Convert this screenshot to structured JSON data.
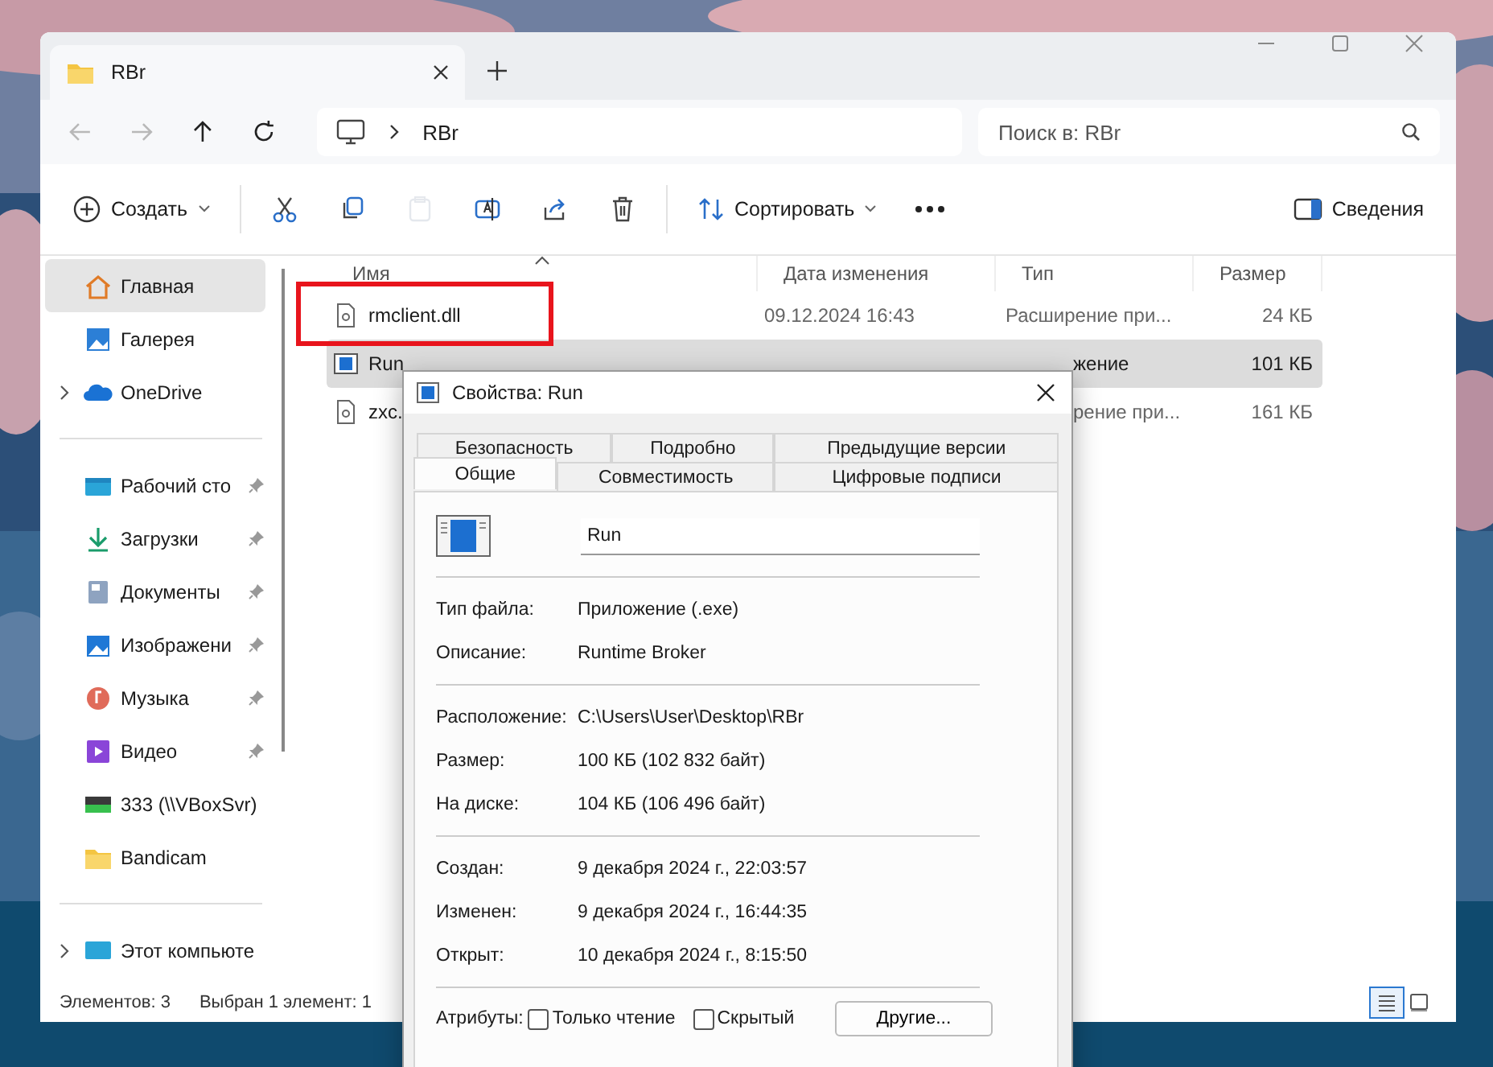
{
  "explorer": {
    "tab": {
      "title": "RBr"
    },
    "nav": [
      {
        "kind": "back",
        "disabled": true
      },
      {
        "kind": "forward",
        "disabled": true
      },
      {
        "kind": "up",
        "disabled": false
      },
      {
        "kind": "refresh",
        "disabled": false
      }
    ],
    "address": {
      "crumbs": [
        "RBr"
      ]
    },
    "search": {
      "placeholder": "Поиск в: RBr"
    },
    "commands": [
      {
        "kind": "new",
        "label": "Создать",
        "disabled": false
      },
      {
        "kind": "cut",
        "disabled": false
      },
      {
        "kind": "copy",
        "disabled": false
      },
      {
        "kind": "paste",
        "disabled": true
      },
      {
        "kind": "rename",
        "disabled": false
      },
      {
        "kind": "share",
        "disabled": false
      },
      {
        "kind": "delete",
        "disabled": false
      },
      {
        "kind": "sort",
        "label": "Сортировать",
        "disabled": false
      },
      {
        "kind": "more",
        "disabled": false
      }
    ],
    "details_button": "Сведения",
    "sidebar": {
      "groups": [
        [
          {
            "kind": "home",
            "label": "Главная",
            "selected": true,
            "pinned": false,
            "expandable": false
          },
          {
            "kind": "gallery",
            "label": "Галерея",
            "selected": false,
            "pinned": false,
            "expandable": false
          },
          {
            "kind": "cloud",
            "label": "OneDrive",
            "selected": false,
            "pinned": false,
            "expandable": true
          }
        ],
        [
          {
            "kind": "desktop",
            "label": "Рабочий сто",
            "selected": false,
            "pinned": true,
            "expandable": false
          },
          {
            "kind": "downloads",
            "label": "Загрузки",
            "selected": false,
            "pinned": true,
            "expandable": false
          },
          {
            "kind": "documents",
            "label": "Документы",
            "selected": false,
            "pinned": true,
            "expandable": false
          },
          {
            "kind": "pictures",
            "label": "Изображени",
            "selected": false,
            "pinned": true,
            "expandable": false
          },
          {
            "kind": "music",
            "label": "Музыка",
            "selected": false,
            "pinned": true,
            "expandable": false
          },
          {
            "kind": "video",
            "label": "Видео",
            "selected": false,
            "pinned": true,
            "expandable": false
          },
          {
            "kind": "drive",
            "label": "333 (\\\\VBoxSvr)",
            "selected": false,
            "pinned": false,
            "expandable": false
          },
          {
            "kind": "folder",
            "label": "Bandicam",
            "selected": false,
            "pinned": false,
            "expandable": false
          }
        ],
        [
          {
            "kind": "computer",
            "label": "Этот компьюте",
            "selected": false,
            "pinned": false,
            "expandable": true
          }
        ]
      ]
    },
    "table": {
      "columns": [
        {
          "label": "Имя",
          "sorted": true
        },
        {
          "label": "Дата изменения",
          "sorted": false
        },
        {
          "label": "Тип",
          "sorted": false
        },
        {
          "label": "Размер",
          "sorted": false
        }
      ],
      "rows": [
        {
          "kind": "dll",
          "name": "rmclient.dll",
          "date": "09.12.2024 16:43",
          "type": "Расширение при...",
          "size": "24 КБ",
          "selected": false,
          "highlighted": true
        },
        {
          "kind": "exe",
          "name": "Run",
          "type": "жение",
          "size": "101 КБ",
          "selected": true,
          "highlighted": false
        },
        {
          "kind": "dll",
          "name": "zxc.",
          "type": "рение при...",
          "size": "161 КБ",
          "selected": false,
          "highlighted": false
        }
      ]
    },
    "status_bar": {
      "count": "Элементов: 3",
      "selection": "Выбран 1 элемент: 1"
    },
    "views": [
      {
        "kind": "details",
        "selected": true
      },
      {
        "kind": "tiles",
        "selected": false
      }
    ]
  },
  "dialog": {
    "title": "Свойства: Run",
    "tab_rows": [
      [
        {
          "label": "Безопасность",
          "selected": false
        },
        {
          "label": "Подробно",
          "selected": false
        },
        {
          "label": "Предыдущие версии",
          "selected": false
        }
      ],
      [
        {
          "label": "Общие",
          "selected": true
        },
        {
          "label": "Совместимость",
          "selected": false
        },
        {
          "label": "Цифровые подписи",
          "selected": false
        }
      ]
    ],
    "name_field": {
      "value": "Run"
    },
    "sections": [
      [
        {
          "label": "Тип файла:",
          "value": "Приложение (.exe)"
        },
        {
          "label": "Описание:",
          "value": "Runtime Broker"
        }
      ],
      [
        {
          "label": "Расположение:",
          "value": "C:\\Users\\User\\Desktop\\RBr"
        },
        {
          "label": "Размер:",
          "value": "100 КБ (102 832 байт)"
        },
        {
          "label": "На диске:",
          "value": "104 КБ (106 496 байт)"
        }
      ],
      [
        {
          "label": "Создан:",
          "value": "9 декабря 2024 г., 22:03:57"
        },
        {
          "label": "Изменен:",
          "value": "9 декабря 2024 г., 16:44:35"
        },
        {
          "label": "Открыт:",
          "value": "10 декабря 2024 г., 8:15:50"
        }
      ]
    ],
    "attributes": {
      "label": "Атрибуты:",
      "checkboxes": [
        {
          "label": "Только чтение",
          "checked": false
        },
        {
          "label": "Скрытый",
          "checked": false
        }
      ],
      "button": "Другие..."
    }
  }
}
